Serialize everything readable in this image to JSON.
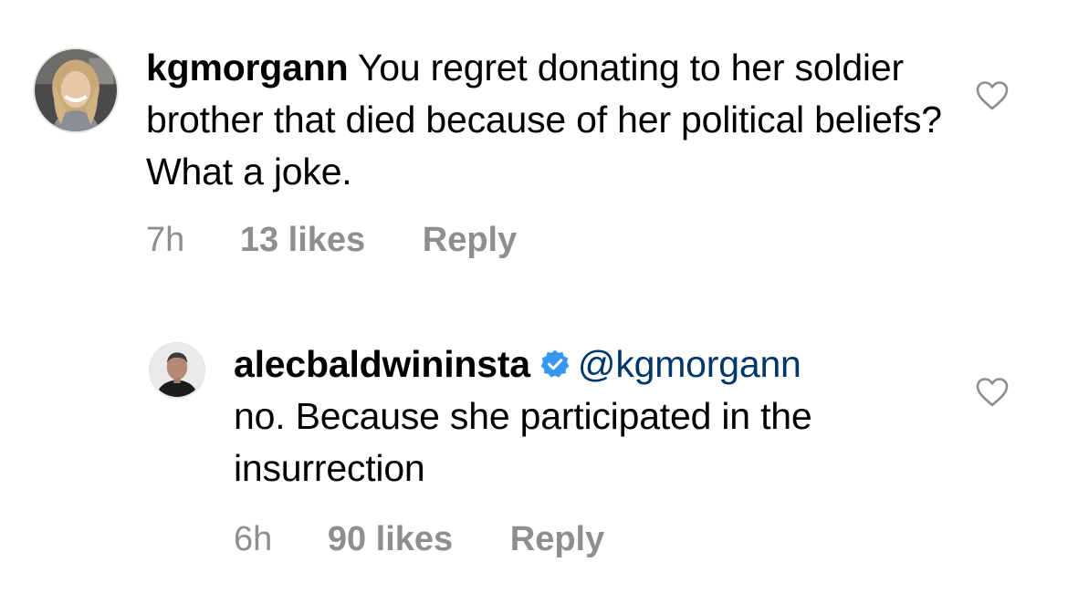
{
  "comments": [
    {
      "username": "kgmorgann",
      "text": " You regret donating to her soldier brother that died because of her political beliefs? What a joke.",
      "time": "7h",
      "likes": "13 likes",
      "reply_label": "Reply",
      "avatar_icon": "user-avatar-photo",
      "like_icon": "heart-outline-icon"
    },
    {
      "username": "alecbaldwininsta",
      "verified": true,
      "mention": "@kgmorgann",
      "text": "no. Because she participated in the insurrection",
      "time": "6h",
      "likes": "90 likes",
      "reply_label": "Reply",
      "avatar_icon": "user-avatar-photo",
      "like_icon": "heart-outline-icon"
    }
  ],
  "colors": {
    "text": "#000000",
    "meta": "#8e8e8e",
    "mention": "#00376b",
    "verified": "#3897f0"
  }
}
